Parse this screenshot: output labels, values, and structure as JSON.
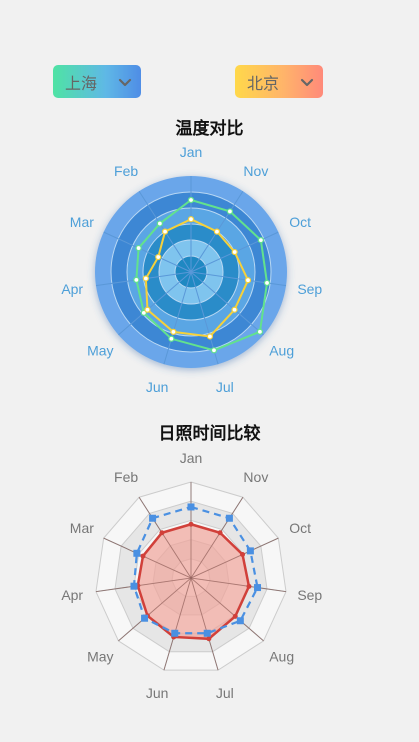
{
  "selectors": {
    "left": {
      "value": "上海",
      "icon": "chevron-down-icon"
    },
    "right": {
      "value": "北京",
      "icon": "chevron-down-icon"
    }
  },
  "chart_data": [
    {
      "type": "radar",
      "title": "温度对比",
      "indicators": [
        "Jan",
        "Nov",
        "Oct",
        "Sep",
        "Aug",
        "Jul",
        "Jun",
        "May",
        "Apr",
        "Mar",
        "Feb"
      ],
      "max": 40,
      "series": [
        {
          "values": [
            30,
            30,
            32,
            32,
            38,
            34,
            29,
            26,
            23,
            24,
            24
          ],
          "color": "#62e28d"
        },
        {
          "values": [
            22,
            20,
            20,
            24,
            24,
            28,
            26,
            24,
            19,
            15,
            20
          ],
          "color": "#f6d13a"
        }
      ],
      "colors": {
        "label": "#4d9fd8",
        "rings": [
          "#6aa6ea",
          "#3d87d4",
          "#5aa6e4",
          "#2a8cc9",
          "#7fc4ee",
          "#1f88c2"
        ]
      }
    },
    {
      "type": "radar",
      "title": "日照时间比较",
      "indicators": [
        "Jan",
        "Nov",
        "Oct",
        "Sep",
        "Aug",
        "Jul",
        "Jun",
        "May",
        "Apr",
        "Mar",
        "Feb"
      ],
      "max": 100,
      "series": [
        {
          "values": [
            74,
            74,
            68,
            70,
            68,
            60,
            60,
            64,
            60,
            62,
            74
          ],
          "color": "#4a90e2",
          "style": "dashed"
        },
        {
          "values": [
            56,
            56,
            59,
            61,
            61,
            66,
            64,
            60,
            56,
            55,
            56
          ],
          "color": "#d1403a",
          "style": "solid"
        }
      ],
      "colors": {
        "label": "#777777",
        "fill": "#f0a49a"
      }
    }
  ]
}
